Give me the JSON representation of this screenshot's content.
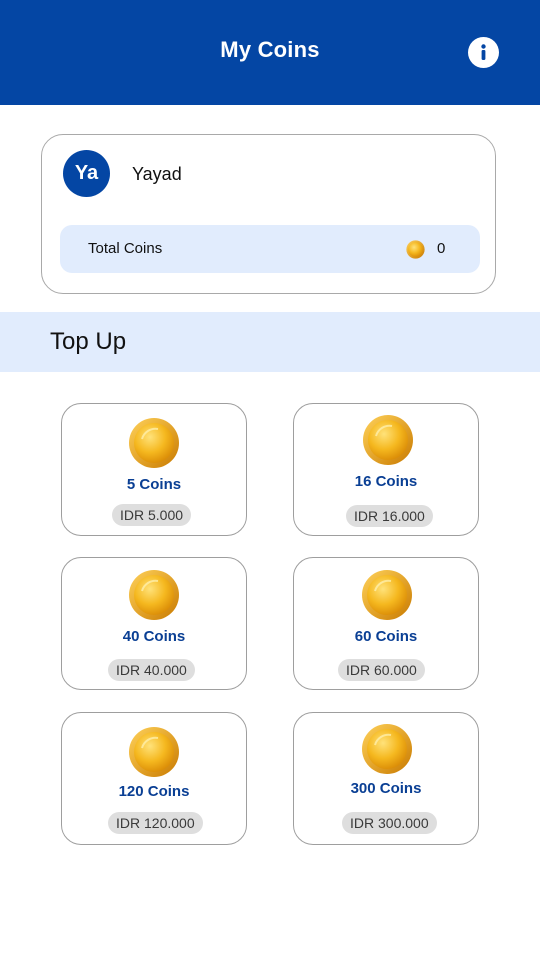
{
  "header": {
    "title": "My Coins",
    "info_icon": "info-icon"
  },
  "user": {
    "avatar_initials": "Ya",
    "name": "Yayad",
    "total_coins_label": "Total Coins",
    "total_coins_value": "0"
  },
  "topup": {
    "title": "Top Up",
    "packages": [
      {
        "coins": "5 Coins",
        "price": "IDR 5.000"
      },
      {
        "coins": "16 Coins",
        "price": "IDR 16.000"
      },
      {
        "coins": "40 Coins",
        "price": "IDR 40.000"
      },
      {
        "coins": "60 Coins",
        "price": "IDR 60.000"
      },
      {
        "coins": "120 Coins",
        "price": "IDR 120.000"
      },
      {
        "coins": "300 Coins",
        "price": "IDR 300.000"
      }
    ]
  },
  "colors": {
    "primary": "#0446a4",
    "light_blue": "#e1ecfd",
    "coin_gold": "#f3b41c"
  }
}
